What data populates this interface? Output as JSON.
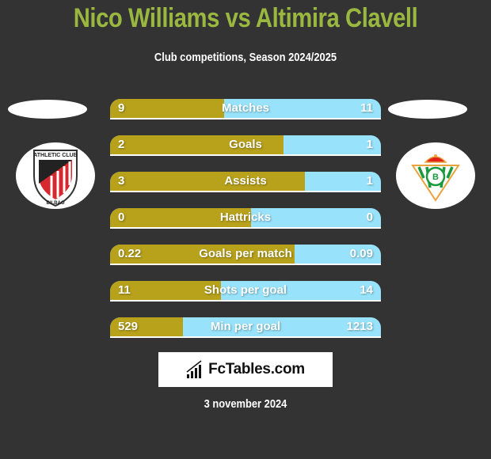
{
  "header": {
    "title": "Nico Williams vs Altimira Clavell",
    "subtitle": "Club competitions, Season 2024/2025"
  },
  "players": {
    "left": {
      "name": "Nico Williams",
      "club_icon": "athletic-club-bilbao-crest"
    },
    "right": {
      "name": "Altimira Clavell",
      "club_icon": "real-betis-crest"
    }
  },
  "colors": {
    "left": "#b8a11b",
    "right": "#98e3fb",
    "title": "#9ab840",
    "background": "#333333"
  },
  "stats": [
    {
      "label": "Matches",
      "left": "9",
      "right": "11",
      "left_share": 0.42
    },
    {
      "label": "Goals",
      "left": "2",
      "right": "1",
      "left_share": 0.64
    },
    {
      "label": "Assists",
      "left": "3",
      "right": "1",
      "left_share": 0.72
    },
    {
      "label": "Hattricks",
      "left": "0",
      "right": "0",
      "left_share": 0.52
    },
    {
      "label": "Goals per match",
      "left": "0.22",
      "right": "0.09",
      "left_share": 0.68
    },
    {
      "label": "Shots per goal",
      "left": "11",
      "right": "14",
      "left_share": 0.41
    },
    {
      "label": "Min per goal",
      "left": "529",
      "right": "1213",
      "left_share": 0.27
    }
  ],
  "footer": {
    "brand": "FcTables.com",
    "date": "3 november 2024"
  }
}
